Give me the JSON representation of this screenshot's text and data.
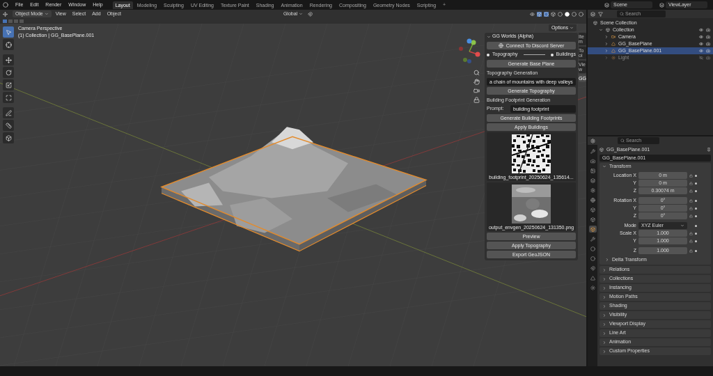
{
  "menu": [
    "File",
    "Edit",
    "Render",
    "Window",
    "Help"
  ],
  "workspaces": [
    {
      "label": "Layout",
      "selected": true
    },
    {
      "label": "Modeling",
      "selected": false
    },
    {
      "label": "Sculpting",
      "selected": false
    },
    {
      "label": "UV Editing",
      "selected": false
    },
    {
      "label": "Texture Paint",
      "selected": false
    },
    {
      "label": "Shading",
      "selected": false
    },
    {
      "label": "Animation",
      "selected": false
    },
    {
      "label": "Rendering",
      "selected": false
    },
    {
      "label": "Compositing",
      "selected": false
    },
    {
      "label": "Geometry Nodes",
      "selected": false
    },
    {
      "label": "Scripting",
      "selected": false
    }
  ],
  "add_workspace": "+",
  "scene": "Scene",
  "view_layer": "ViewLayer",
  "viewport_header": {
    "mode": "Object Mode",
    "menus": [
      "View",
      "Select",
      "Add",
      "Object"
    ],
    "orientation": "Global",
    "options": "Options"
  },
  "viewport": {
    "title": "Camera Perspective",
    "subtitle": "(1) Collection | GG_BasePlane.001"
  },
  "tools": [
    {
      "selected": true
    },
    {
      "selected": false
    },
    {
      "selected": false
    },
    {
      "selected": false
    },
    {
      "selected": false
    },
    {
      "selected": false
    },
    {
      "selected": false
    },
    {
      "selected": false
    },
    {
      "selected": false
    }
  ],
  "side_tabs": [
    {
      "label": "Item",
      "selected": false
    },
    {
      "label": "Tool",
      "selected": false
    },
    {
      "label": "View",
      "selected": false
    },
    {
      "label": "GG",
      "selected": true
    }
  ],
  "addon_panel": {
    "title": "GG Worlds (Alpha)",
    "items": [
      {
        "kind": "button",
        "label": "Connect To Discord Server"
      },
      {
        "kind": "pair",
        "left": "Topography",
        "right": "Buildings"
      },
      {
        "kind": "button",
        "label": "Generate Base Plane"
      },
      {
        "kind": "label",
        "label": "Topography Generation"
      },
      {
        "kind": "field",
        "value": "a chain of mountains with deep valleys"
      },
      {
        "kind": "button",
        "label": "Generate Topography"
      },
      {
        "kind": "label",
        "label": "Building Footprint Generation"
      },
      {
        "kind": "prompt",
        "label": "Prompt:",
        "value": "building footprint"
      },
      {
        "kind": "button",
        "label": "Generate Building Footprints"
      },
      {
        "kind": "button",
        "label": "Apply Buildings"
      },
      {
        "caption": "building_footprint_20250624_135614..."
      },
      {
        "caption": "output_envgen_20250624_131350.png"
      },
      {
        "kind": "button",
        "label": "Preview"
      },
      {
        "kind": "button",
        "label": "Apply Topography"
      },
      {
        "kind": "button",
        "label": "Export GeoJSON"
      }
    ]
  },
  "outliner": {
    "search_placeholder": "Search",
    "root": "Scene Collection",
    "collection": "Collection",
    "objects": [
      {
        "name": "Camera",
        "selected": false,
        "visible": true
      },
      {
        "name": "GG_BasePlane",
        "selected": false,
        "visible": true
      },
      {
        "name": "GG_BasePlane.001",
        "selected": true,
        "visible": true
      },
      {
        "name": "Light",
        "selected": false,
        "visible": false
      }
    ]
  },
  "properties": {
    "search_placeholder": "Search",
    "object_name": "GG_BasePlane.001",
    "data_name": "GG_BasePlane.001",
    "tabs": [
      {
        "selected": false
      },
      {
        "selected": false
      },
      {
        "selected": false
      },
      {
        "selected": false
      },
      {
        "selected": false
      },
      {
        "selected": false
      },
      {
        "selected": false
      },
      {
        "selected": false
      },
      {
        "selected": true
      },
      {
        "selected": false
      },
      {
        "selected": false
      },
      {
        "selected": false
      },
      {
        "selected": false
      },
      {
        "selected": false
      },
      {
        "selected": false
      }
    ],
    "transform": {
      "title": "Transform",
      "rows": [
        {
          "kind": "number",
          "label": "Location X",
          "value": "0 m"
        },
        {
          "kind": "number",
          "label": "Y",
          "value": "0 m"
        },
        {
          "kind": "number",
          "label": "Z",
          "value": "0.30074 m"
        },
        {
          "kind": "number",
          "label": "Rotation X",
          "value": "0°"
        },
        {
          "kind": "number",
          "label": "Y",
          "value": "0°"
        },
        {
          "kind": "number",
          "label": "Z",
          "value": "0°"
        },
        {
          "kind": "dropdown",
          "label": "Mode",
          "value": "XYZ Euler"
        },
        {
          "kind": "number",
          "label": "Scale X",
          "value": "1.000"
        },
        {
          "kind": "number",
          "label": "Y",
          "value": "1.000"
        },
        {
          "kind": "number",
          "label": "Z",
          "value": "1.000"
        }
      ],
      "subpanel": "Delta Transform"
    },
    "panels": [
      "Relations",
      "Collections",
      "Instancing",
      "Motion Paths",
      "Shading",
      "Visibility",
      "Viewport Display",
      "Line Art",
      "Animation",
      "Custom Properties"
    ]
  }
}
